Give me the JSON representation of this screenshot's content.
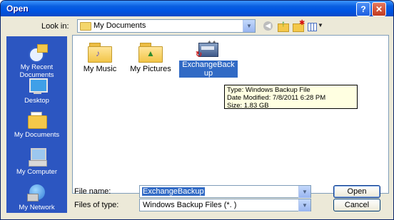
{
  "window": {
    "title": "Open",
    "help_glyph": "?",
    "close_glyph": "✕"
  },
  "toolbar": {
    "lookin_label": "Look in:",
    "lookin_value": "My Documents"
  },
  "places": [
    {
      "label_lines": [
        "My Recent",
        "Documents"
      ],
      "icon": "recent-documents-icon"
    },
    {
      "label_lines": [
        "Desktop"
      ],
      "icon": "desktop-icon"
    },
    {
      "label_lines": [
        "My Documents"
      ],
      "icon": "my-documents-icon"
    },
    {
      "label_lines": [
        "My Computer"
      ],
      "icon": "my-computer-icon"
    },
    {
      "label_lines": [
        "My Network"
      ],
      "icon": "my-network-icon"
    }
  ],
  "files": [
    {
      "name": "My Music",
      "icon": "music-folder-icon"
    },
    {
      "name": "My Pictures",
      "icon": "pictures-folder-icon"
    },
    {
      "name_lines": [
        "ExchangeBack",
        "up"
      ],
      "icon": "windows-backup-file-icon",
      "selected": true
    }
  ],
  "tooltip": {
    "type": "Type: Windows Backup File",
    "modified": "Date Modified: 7/8/2011 6:28 PM",
    "size": "Size: 1.83 GB"
  },
  "filename": {
    "label": "File name:",
    "value": "ExchangeBackup"
  },
  "filetype": {
    "label": "Files of type:",
    "value": "Windows Backup Files (*. )"
  },
  "buttons": {
    "open": "Open",
    "cancel": "Cancel"
  },
  "colors": {
    "titlebar": "#0054e3",
    "places_bar": "#2c56c1",
    "selection": "#316ac5",
    "tooltip_bg": "#ffffe1"
  }
}
